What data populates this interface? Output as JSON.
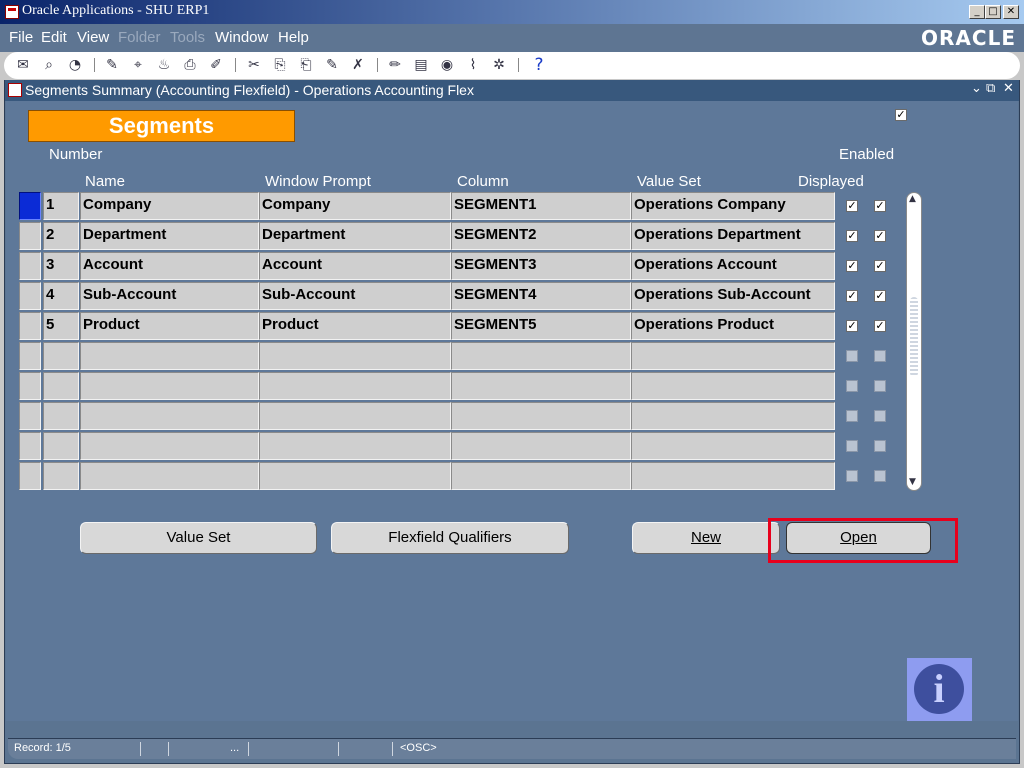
{
  "window": {
    "title": "Oracle Applications - SHU ERP1",
    "btn_min": "_",
    "btn_max": "□",
    "btn_close": "✕"
  },
  "menu": [
    {
      "label": "File",
      "enabled": true
    },
    {
      "label": "Edit",
      "enabled": true
    },
    {
      "label": "View",
      "enabled": true
    },
    {
      "label": "Folder",
      "enabled": false
    },
    {
      "label": "Tools",
      "enabled": false
    },
    {
      "label": "Window",
      "enabled": true
    },
    {
      "label": "Help",
      "enabled": true
    }
  ],
  "brand": "ORACLE",
  "toolbar": {
    "icons": [
      "new-icon",
      "find-icon",
      "navigator-icon",
      "save-icon",
      "next-step-icon",
      "switch-responsibility-icon",
      "print-icon",
      "close-form-icon",
      "cut-icon",
      "copy-icon",
      "paste-icon",
      "clear-record-icon",
      "delete-record-icon",
      "edit-field-icon",
      "zoom-icon",
      "translations-icon",
      "attachments-icon",
      "folder-tools-icon",
      "help-icon"
    ],
    "glyphs": [
      "✉",
      "⌕",
      "◔",
      "✎",
      "⌖",
      "♨",
      "⎙",
      "✐",
      "✂",
      "⎘",
      "⎗",
      "✎",
      "✗",
      "✏",
      "▤",
      "◉",
      "⌇",
      "✲",
      "?"
    ]
  },
  "form": {
    "title": "Segments Summary (Accounting Flexfield) - Operations Accounting Flex",
    "ctl_min": "⌄",
    "ctl_max": "⧉",
    "ctl_close": "✕",
    "header_label": "Segments",
    "columns": {
      "number": "Number",
      "name": "Name",
      "window_prompt": "Window Prompt",
      "column": "Column",
      "value_set": "Value Set",
      "enabled": "Enabled",
      "displayed": "Displayed"
    },
    "rows": [
      {
        "number": "1",
        "name": "Company",
        "window_prompt": "Company",
        "column": "SEGMENT1",
        "value_set": "Operations Company",
        "displayed": true,
        "enabled": true
      },
      {
        "number": "2",
        "name": "Department",
        "window_prompt": "Department",
        "column": "SEGMENT2",
        "value_set": "Operations Department",
        "displayed": true,
        "enabled": true
      },
      {
        "number": "3",
        "name": "Account",
        "window_prompt": "Account",
        "column": "SEGMENT3",
        "value_set": "Operations Account",
        "displayed": true,
        "enabled": true
      },
      {
        "number": "4",
        "name": "Sub-Account",
        "window_prompt": "Sub-Account",
        "column": "SEGMENT4",
        "value_set": "Operations Sub-Account",
        "displayed": true,
        "enabled": true
      },
      {
        "number": "5",
        "name": "Product",
        "window_prompt": "Product",
        "column": "SEGMENT5",
        "value_set": "Operations Product",
        "displayed": true,
        "enabled": true
      },
      {
        "number": "",
        "name": "",
        "window_prompt": "",
        "column": "",
        "value_set": "",
        "displayed": false,
        "enabled": false
      },
      {
        "number": "",
        "name": "",
        "window_prompt": "",
        "column": "",
        "value_set": "",
        "displayed": false,
        "enabled": false
      },
      {
        "number": "",
        "name": "",
        "window_prompt": "",
        "column": "",
        "value_set": "",
        "displayed": false,
        "enabled": false
      },
      {
        "number": "",
        "name": "",
        "window_prompt": "",
        "column": "",
        "value_set": "",
        "displayed": false,
        "enabled": false
      },
      {
        "number": "",
        "name": "",
        "window_prompt": "",
        "column": "",
        "value_set": "",
        "displayed": false,
        "enabled": false
      }
    ],
    "freeze_checkbox": true,
    "buttons": {
      "value_set": "Value Set",
      "flexfield_qualifiers": "Flexfield Qualifiers",
      "new": "New",
      "open": "Open"
    },
    "highlight_color": "#e8001c",
    "info_glyph": "i"
  },
  "status": {
    "record": "Record: 1/5",
    "ellipsis": "...",
    "mode": "<OSC>"
  },
  "colors": {
    "panel": "#5e7899",
    "accent": "#ff9a00",
    "cell": "#cfcfcf",
    "current_row": "#0b2bd6"
  }
}
